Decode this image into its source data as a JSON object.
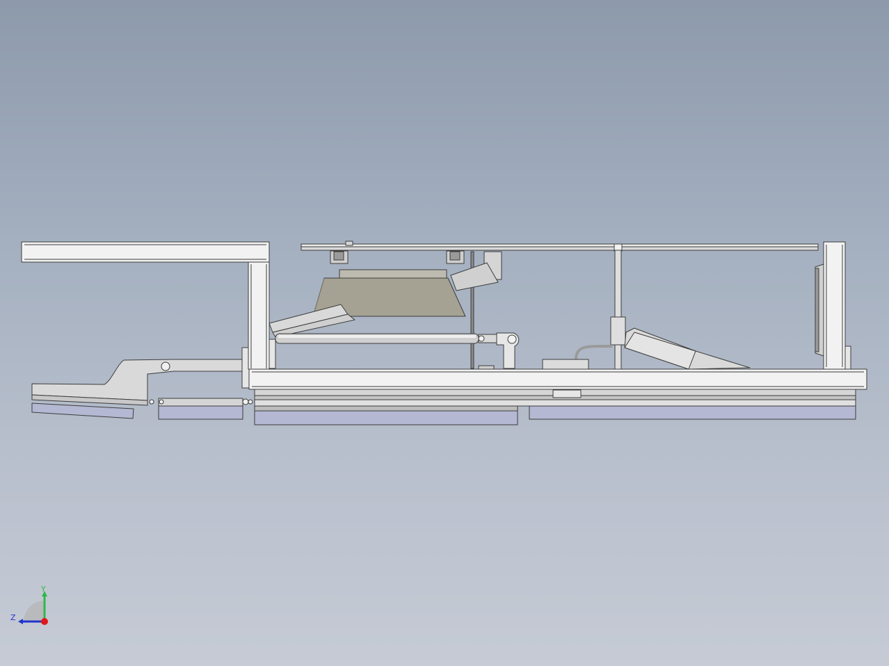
{
  "viewport": {
    "background_top": "#8d9aab",
    "background_bottom": "#c6cbd5"
  },
  "model": {
    "line_color": "#3c3c3c",
    "part_fill": "#e6e6e6",
    "metal_fill": "#c9c9c9",
    "lamp_fill": "#a5a294",
    "bottom_fill": "#b4b8d2"
  },
  "triad": {
    "x_label": "",
    "y_label": "Y",
    "z_label": "Z",
    "y_color": "#2fb84a",
    "z_color": "#2233cc",
    "origin_color": "#e01818"
  }
}
